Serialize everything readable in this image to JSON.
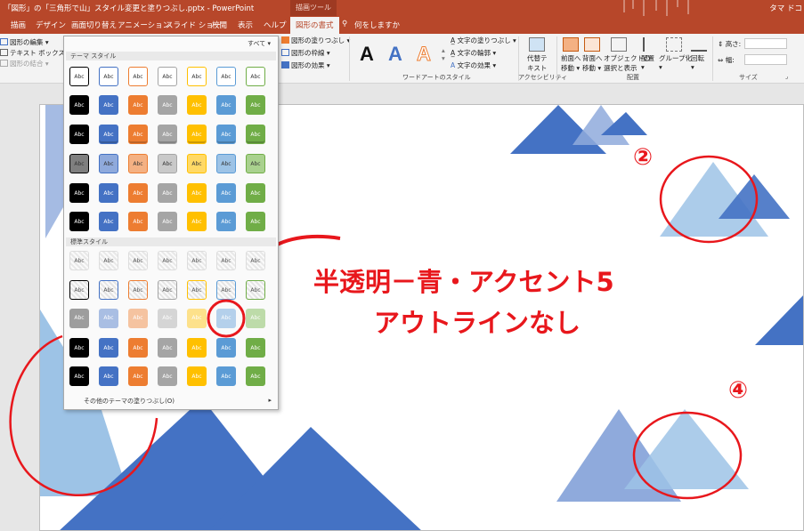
{
  "app": {
    "window_title": "「図形」の「三角形で山」スタイル変更と塗りつぶし.pptx - PowerPoint",
    "context_tab_group": "描画ツール",
    "user": "タマ ドコ"
  },
  "tabs": [
    {
      "label": "描画"
    },
    {
      "label": "デザイン"
    },
    {
      "label": "画面切り替え"
    },
    {
      "label": "アニメーション"
    },
    {
      "label": "スライド ショー"
    },
    {
      "label": "校閲"
    },
    {
      "label": "表示"
    },
    {
      "label": "ヘルプ"
    },
    {
      "label": "図形の書式",
      "active": true
    },
    {
      "label": "何をしますか"
    }
  ],
  "ribbon": {
    "insert": {
      "edit_shape": "図形の編集",
      "text_box": "テキスト ボックス",
      "merge": "図形の結合"
    },
    "styles": {
      "fill": "図形の塗りつぶし",
      "outline": "図形の枠線",
      "effects": "図形の効果"
    },
    "wordart": {
      "letters": [
        "A",
        "A",
        "A"
      ],
      "text_fill": "文字の塗りつぶし",
      "text_outline": "文字の輪郭",
      "text_effects": "文字の効果",
      "group_label": "ワードアートのスタイル"
    },
    "accessibility": {
      "alt_text_1": "代替テ",
      "alt_text_2": "キスト",
      "group_label": "アクセシビリティ"
    },
    "arrange": {
      "bring_forward_1": "前面へ",
      "bring_forward_2": "移動",
      "send_backward_1": "背面へ",
      "send_backward_2": "移動",
      "selection_1": "オブジェクトの",
      "selection_2": "選択と表示",
      "align": "配置",
      "group": "グループ化",
      "rotate": "回転",
      "group_label": "配置"
    },
    "size": {
      "height_label": "高さ:",
      "width_label": "幅:",
      "group_label": "サイズ"
    }
  },
  "gallery": {
    "more_label": "すべて",
    "theme_header": "テーマ スタイル",
    "preset_header": "標準スタイル",
    "cell_label": "Abc",
    "footer": "その他のテーマの塗りつぶし(O)",
    "colors": [
      "#000000",
      "#4472c4",
      "#ed7d31",
      "#a5a5a5",
      "#ffc000",
      "#5b9bd5",
      "#70ad47"
    ],
    "selected": {
      "row": 7,
      "col": 5
    }
  },
  "annotations": {
    "callout_line1": "半透明－青・アクセント5",
    "callout_line2": "アウトラインなし",
    "num2": "②",
    "num4": "④",
    "colors": {
      "annotation": "#e8171c"
    }
  },
  "theme_colors": {
    "ribbon": "#b7472a",
    "accent": "#4472c4",
    "light_blue": "#9dc3e6"
  }
}
